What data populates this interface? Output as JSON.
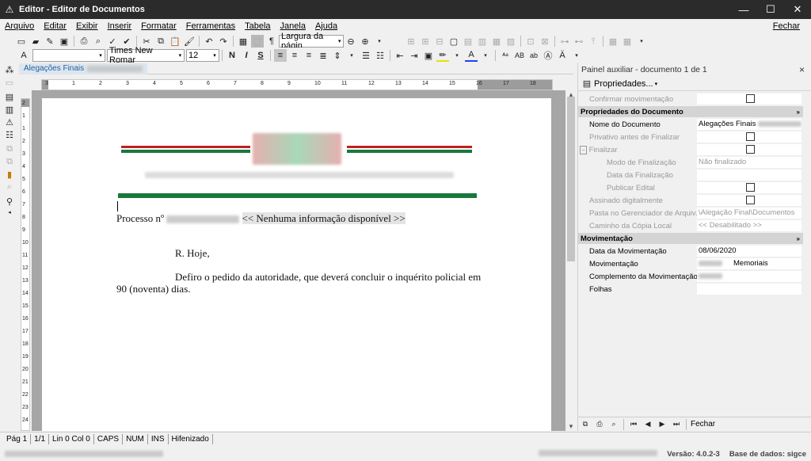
{
  "window": {
    "title": "Editor - Editor de Documentos",
    "minimize": "—",
    "maximize": "☐",
    "close": "✕"
  },
  "menu": {
    "items": [
      "Arquivo",
      "Editar",
      "Exibir",
      "Inserir",
      "Formatar",
      "Ferramentas",
      "Tabela",
      "Janela",
      "Ajuda"
    ],
    "close_label": "Fechar"
  },
  "toolbar": {
    "zoom_value": "Largura da págin",
    "font_name": "Times New Romar",
    "font_size": "12"
  },
  "tab": {
    "label": "Alegações Finais"
  },
  "document": {
    "process_prefix": "Processo nº",
    "process_placeholder": "<< Nenhuma informação disponível >>",
    "line1": "R. Hoje,",
    "line2": "Defiro o pedido da autoridade, que deverá concluir o inquérito policial em",
    "line3": "90 (noventa) dias."
  },
  "ruler": {
    "labels": [
      "3",
      "1",
      "2",
      "3",
      "4",
      "5",
      "6",
      "7",
      "8",
      "9",
      "10",
      "11",
      "12",
      "13",
      "14",
      "15",
      "16",
      "17",
      "18"
    ]
  },
  "vruler": {
    "labels": [
      "2",
      "1",
      "1",
      "2",
      "3",
      "4",
      "5",
      "6",
      "7",
      "8",
      "9",
      "10",
      "11",
      "12",
      "13",
      "14",
      "15",
      "16",
      "17",
      "18",
      "19",
      "20",
      "21",
      "22",
      "23",
      "24"
    ]
  },
  "panel": {
    "title": "Painel auxiliar - documento 1 de 1",
    "close": "×",
    "props_button": "Propriedades...",
    "confirm_row": "Confirmar movimentação",
    "cat_doc": "Propriedades do Documento",
    "doc_name_label": "Nome do Documento",
    "doc_name_value": "Alegações Finais",
    "private_label": "Privativo antes de Finalizar",
    "finalize_label": "Finalizar",
    "finalize_mode_label": "Modo de Finalização",
    "finalize_mode_value": "Não finalizado",
    "finalize_date_label": "Data da Finalização",
    "publish_label": "Publicar Edital",
    "signed_label": "Assinado digitalmente",
    "folder_label": "Pasta no Gerenciador de Arquiv...",
    "folder_value": "\\Alegação Final\\Documentos",
    "copy_path_label": "Caminho da Cópia Local",
    "copy_path_value": "<< Desabilitado >>",
    "cat_mov": "Movimentação",
    "mov_date_label": "Data da Movimentação",
    "mov_date_value": "08/06/2020",
    "mov_label": "Movimentação",
    "mov_value": "Memoriais",
    "mov_comp_label": "Complemento da Movimentação",
    "sheets_label": "Folhas",
    "nav_close": "Fechar"
  },
  "statusbar": {
    "page": "Pág 1",
    "pages": "1/1",
    "cursor": "Lin 0  Col 0",
    "caps": "CAPS",
    "num": "NUM",
    "ins": "INS",
    "hyphen": "Hifenizado"
  },
  "footer": {
    "version": "Versão: 4.0.2-3",
    "database": "Base de dados: sigce"
  }
}
